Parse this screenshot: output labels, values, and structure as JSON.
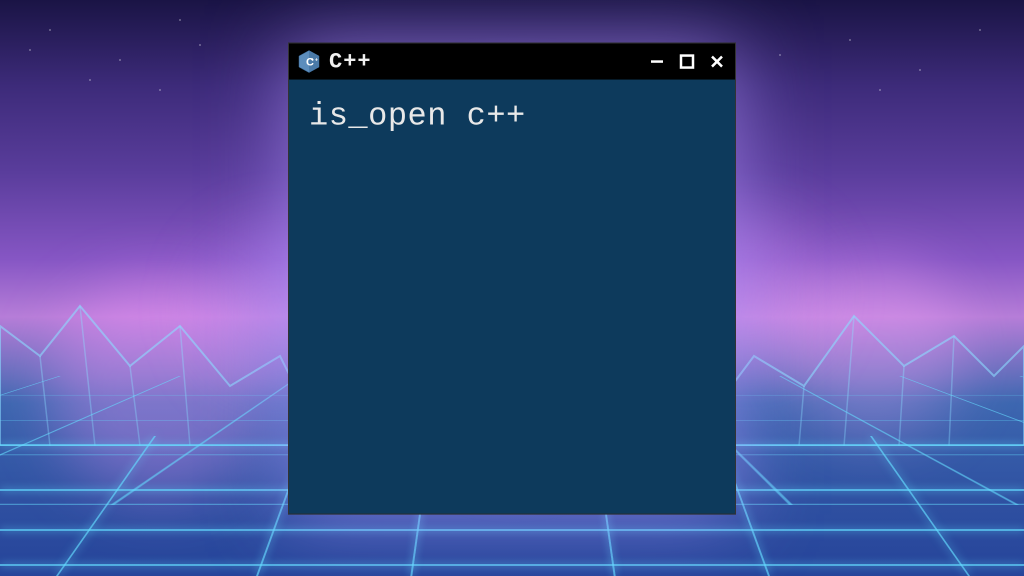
{
  "window": {
    "title": "C++",
    "icon_name": "cpp-logo-icon",
    "content_text": "is_open c++"
  },
  "controls": {
    "minimize": "minimize",
    "maximize": "maximize",
    "close": "close"
  },
  "colors": {
    "window_body": "#0d3a5c",
    "titlebar": "#000000",
    "text": "#e8e8e8"
  }
}
